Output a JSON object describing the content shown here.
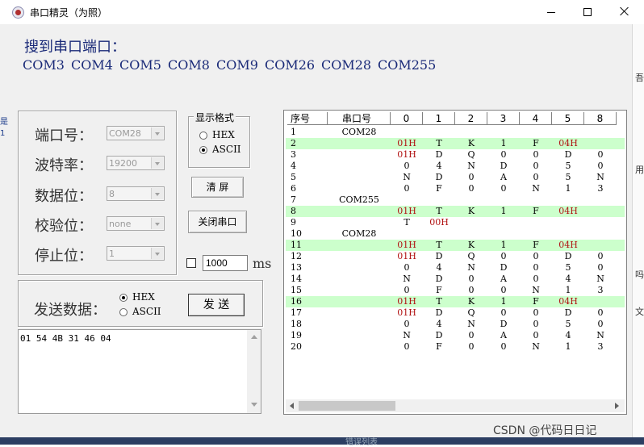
{
  "window": {
    "title": "串口精灵（为照）"
  },
  "ports_section": {
    "label": "搜到串口端口：",
    "ports": [
      "COM3",
      "COM4",
      "COM5",
      "COM8",
      "COM9",
      "COM26",
      "COM28",
      "COM255"
    ]
  },
  "settings": {
    "port_label": "端口号：",
    "port_value": "COM28",
    "baud_label": "波特率：",
    "baud_value": "19200",
    "databits_label": "数据位：",
    "databits_value": "8",
    "parity_label": "校验位：",
    "parity_value": "none",
    "stopbits_label": "停止位：",
    "stopbits_value": "1"
  },
  "display_format": {
    "legend": "显示格式",
    "hex_label": "HEX",
    "ascii_label": "ASCII",
    "selected": "ASCII"
  },
  "buttons": {
    "clear": "清 屏",
    "close_port": "关闭串口",
    "send": "发 送"
  },
  "timer": {
    "value": "1000",
    "unit": "ms",
    "checked": false
  },
  "send_panel": {
    "label": "发送数据：",
    "hex_label": "HEX",
    "ascii_label": "ASCII",
    "selected": "HEX",
    "data": "01 54 4B 31 46 04"
  },
  "grid": {
    "headers": [
      "序号",
      "串口号",
      "0",
      "1",
      "2",
      "3",
      "4",
      "5",
      "8"
    ],
    "rows": [
      {
        "cells": [
          "1",
          "COM28",
          "",
          "",
          "",
          "",
          "",
          "",
          ""
        ],
        "hl": false
      },
      {
        "cells": [
          "2",
          "",
          "01H",
          "T",
          "K",
          "1",
          "F",
          "04H",
          ""
        ],
        "hl": true
      },
      {
        "cells": [
          "3",
          "",
          "01H",
          "D",
          "Q",
          "0",
          "0",
          "D",
          "0"
        ],
        "hl": false
      },
      {
        "cells": [
          "4",
          "",
          "0",
          "4",
          "N",
          "D",
          "0",
          "5",
          "0"
        ],
        "hl": false
      },
      {
        "cells": [
          "5",
          "",
          "N",
          "D",
          "0",
          "A",
          "0",
          "5",
          "N"
        ],
        "hl": false
      },
      {
        "cells": [
          "6",
          "",
          "0",
          "F",
          "0",
          "0",
          "N",
          "1",
          "3"
        ],
        "hl": false
      },
      {
        "cells": [
          "7",
          "COM255",
          "",
          "",
          "",
          "",
          "",
          "",
          ""
        ],
        "hl": false
      },
      {
        "cells": [
          "8",
          "",
          "01H",
          "T",
          "K",
          "1",
          "F",
          "04H",
          ""
        ],
        "hl": true
      },
      {
        "cells": [
          "9",
          "",
          "T",
          "00H",
          "",
          "",
          "",
          "",
          ""
        ],
        "hl": false
      },
      {
        "cells": [
          "10",
          "COM28",
          "",
          "",
          "",
          "",
          "",
          "",
          ""
        ],
        "hl": false
      },
      {
        "cells": [
          "11",
          "",
          "01H",
          "T",
          "K",
          "1",
          "F",
          "04H",
          ""
        ],
        "hl": true
      },
      {
        "cells": [
          "12",
          "",
          "01H",
          "D",
          "Q",
          "0",
          "0",
          "D",
          "0"
        ],
        "hl": false
      },
      {
        "cells": [
          "13",
          "",
          "0",
          "4",
          "N",
          "D",
          "0",
          "5",
          "0"
        ],
        "hl": false
      },
      {
        "cells": [
          "14",
          "",
          "N",
          "D",
          "0",
          "A",
          "0",
          "4",
          "N"
        ],
        "hl": false
      },
      {
        "cells": [
          "15",
          "",
          "0",
          "F",
          "0",
          "0",
          "N",
          "1",
          "3"
        ],
        "hl": false
      },
      {
        "cells": [
          "16",
          "",
          "01H",
          "T",
          "K",
          "1",
          "F",
          "04H",
          ""
        ],
        "hl": true
      },
      {
        "cells": [
          "17",
          "",
          "01H",
          "D",
          "Q",
          "0",
          "0",
          "D",
          "0"
        ],
        "hl": false
      },
      {
        "cells": [
          "18",
          "",
          "0",
          "4",
          "N",
          "D",
          "0",
          "5",
          "0"
        ],
        "hl": false
      },
      {
        "cells": [
          "19",
          "",
          "N",
          "D",
          "0",
          "A",
          "0",
          "4",
          "N"
        ],
        "hl": false
      },
      {
        "cells": [
          "20",
          "",
          "0",
          "F",
          "0",
          "0",
          "N",
          "1",
          "3"
        ],
        "hl": false
      }
    ]
  },
  "side_fragments": {
    "right": [
      "吾",
      "用",
      "吗",
      "文"
    ],
    "left": [
      "是",
      "1"
    ]
  },
  "watermark": "CSDN @代码日日记",
  "taskbar_fragment": "错误列表",
  "colors": {
    "accent_text": "#1a2a78",
    "highlight_row": "#ccffcc",
    "hex_value": "#b01010"
  }
}
